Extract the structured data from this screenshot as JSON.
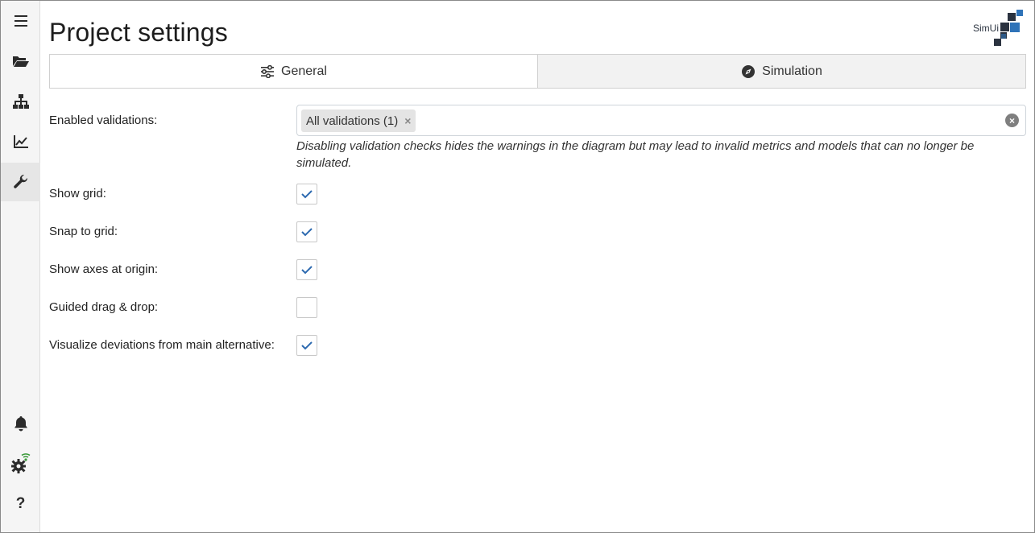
{
  "page": {
    "title": "Project settings"
  },
  "logo": {
    "text": "SimUi"
  },
  "sidebar": {
    "items": [
      {
        "icon": "menu-icon"
      },
      {
        "icon": "folder-open-icon"
      },
      {
        "icon": "sitemap-icon"
      },
      {
        "icon": "chart-line-icon"
      },
      {
        "icon": "wrench-icon"
      },
      {
        "icon": "bell-icon"
      },
      {
        "icon": "gear-wifi-icon"
      },
      {
        "icon": "question-icon",
        "label": "?"
      }
    ]
  },
  "tabs": [
    {
      "label": "General",
      "icon": "sliders-icon",
      "active": true
    },
    {
      "label": "Simulation",
      "icon": "compass-icon",
      "active": false
    }
  ],
  "settings": {
    "validations_label": "Enabled validations:",
    "validations_chip": "All validations (1)",
    "validations_chip_remove": "×",
    "validations_clear": "×",
    "validations_hint": "Disabling validation checks hides the warnings in the diagram but may lead to invalid metrics and models that can no longer be simulated.",
    "options": [
      {
        "label": "Show grid:",
        "checked": true
      },
      {
        "label": "Snap to grid:",
        "checked": true
      },
      {
        "label": "Show axes at origin:",
        "checked": true
      },
      {
        "label": "Guided drag & drop:",
        "checked": false
      },
      {
        "label": "Visualize deviations from main alternative:",
        "checked": true
      }
    ]
  },
  "colors": {
    "accent": "#2d6ab0",
    "logo_dark": "#2b3340",
    "logo_blue": "#2f73b8",
    "status_green": "#3a9a3a"
  }
}
